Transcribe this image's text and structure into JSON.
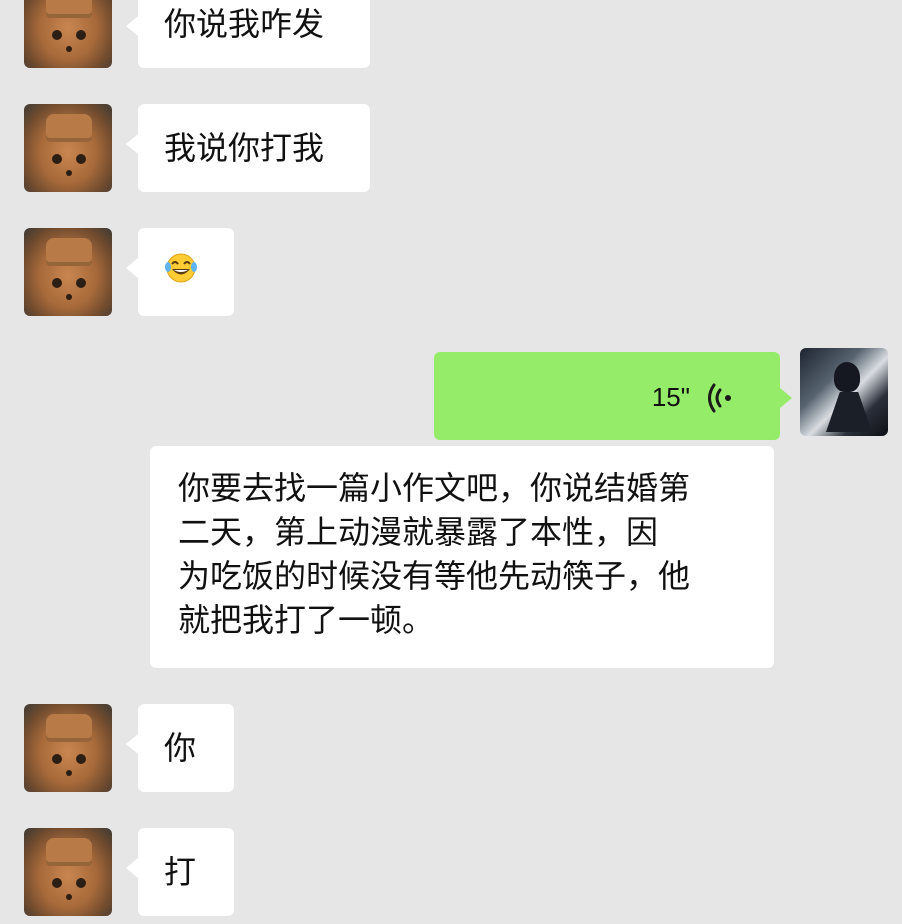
{
  "messages": [
    {
      "side": "left",
      "text": "你说我咋发"
    },
    {
      "side": "left",
      "text": "我说你打我"
    },
    {
      "side": "left",
      "emoji": "laughing-tears-emoji"
    },
    {
      "side": "right",
      "type": "voice",
      "duration": "15\""
    },
    {
      "side": "left",
      "text": "你要去找一篇小作文吧，你说结婚第\n二天，第上动漫就暴露了本性，因\n为吃饭的时候没有等他先动筷子，他\n就把我打了一顿。"
    },
    {
      "side": "left",
      "text": "你"
    },
    {
      "side": "left",
      "text": "打"
    }
  ],
  "colors": {
    "background": "#e6e6e6",
    "bubble_received": "#ffffff",
    "bubble_sent": "#95ec69"
  },
  "icons": {
    "voice": "voice-wave-icon",
    "emoji": "laughing-tears-emoji"
  }
}
